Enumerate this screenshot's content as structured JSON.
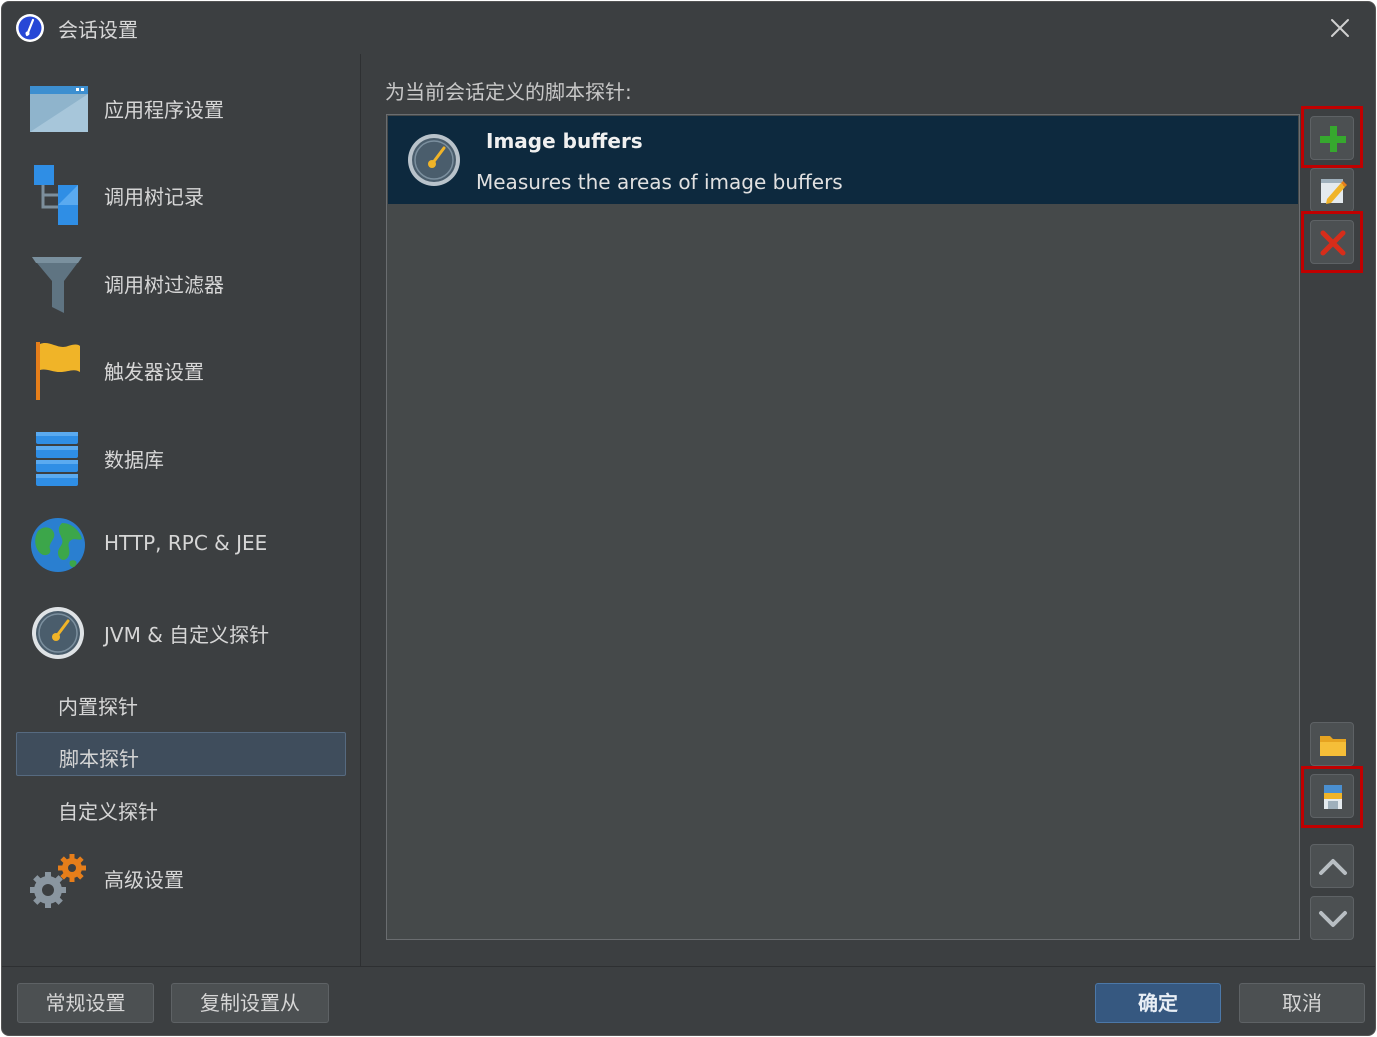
{
  "window": {
    "title": "会话设置"
  },
  "sidebar": {
    "items": [
      {
        "label": "应用程序设置"
      },
      {
        "label": "调用树记录"
      },
      {
        "label": "调用树过滤器"
      },
      {
        "label": "触发器设置"
      },
      {
        "label": "数据库"
      },
      {
        "label": "HTTP, RPC & JEE"
      },
      {
        "label": "JVM & 自定义探针"
      },
      {
        "label": "高级设置"
      }
    ],
    "subitems": [
      {
        "label": "内置探针"
      },
      {
        "label": "脚本探针",
        "selected": true
      },
      {
        "label": "自定义探针"
      }
    ]
  },
  "main": {
    "section_label": "为当前会话定义的脚本探针:",
    "probes": [
      {
        "title": "Image buffers",
        "description": "Measures the areas of image buffers"
      }
    ]
  },
  "footer": {
    "general_settings": "常规设置",
    "copy_settings": "复制设置从",
    "ok": "确定",
    "cancel": "取消"
  },
  "colors": {
    "background": "#3c3f41",
    "selected_row": "#0d293e",
    "accent": "#365880",
    "highlight": "#c00000"
  }
}
